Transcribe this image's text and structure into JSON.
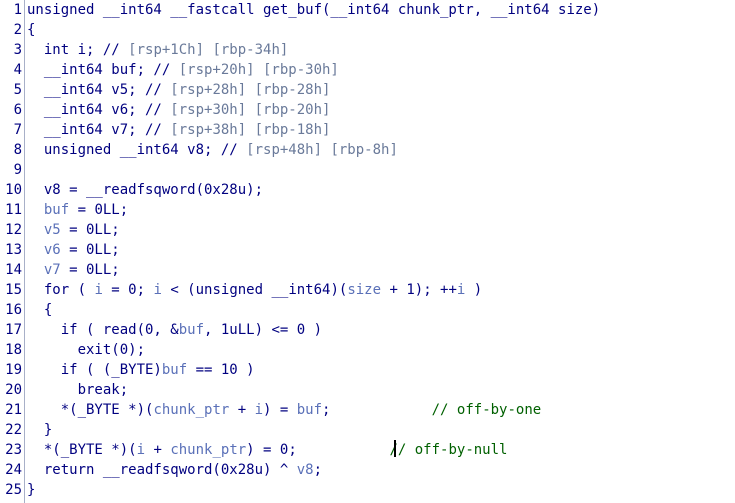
{
  "lines": [
    {
      "n": "1",
      "tokens": [
        [
          "unsigned __int64 __fastcall get_buf(__int64 chunk_ptr, __int64 size)",
          "plain"
        ]
      ]
    },
    {
      "n": "2",
      "tokens": [
        [
          "{",
          "plain"
        ]
      ]
    },
    {
      "n": "3",
      "tokens": [
        [
          "  int i; // ",
          "plain"
        ],
        [
          "[rsp+1Ch] [rbp-34h]",
          "cmt"
        ]
      ]
    },
    {
      "n": "4",
      "tokens": [
        [
          "  __int64 buf; // ",
          "plain"
        ],
        [
          "[rsp+20h] [rbp-30h]",
          "cmt"
        ]
      ]
    },
    {
      "n": "5",
      "tokens": [
        [
          "  __int64 v5; // ",
          "plain"
        ],
        [
          "[rsp+28h] [rbp-28h]",
          "cmt"
        ]
      ]
    },
    {
      "n": "6",
      "tokens": [
        [
          "  __int64 v6; // ",
          "plain"
        ],
        [
          "[rsp+30h] [rbp-20h]",
          "cmt"
        ]
      ]
    },
    {
      "n": "7",
      "tokens": [
        [
          "  __int64 v7; // ",
          "plain"
        ],
        [
          "[rsp+38h] [rbp-18h]",
          "cmt"
        ]
      ]
    },
    {
      "n": "8",
      "tokens": [
        [
          "  unsigned __int64 v8; // ",
          "plain"
        ],
        [
          "[rsp+48h] [rbp-8h]",
          "cmt"
        ]
      ]
    },
    {
      "n": "9",
      "tokens": [
        [
          "",
          "plain"
        ]
      ]
    },
    {
      "n": "10",
      "tokens": [
        [
          "  v8 = __readfsqword(0x28u);",
          "plain"
        ]
      ]
    },
    {
      "n": "11",
      "tokens": [
        [
          "  ",
          "plain"
        ],
        [
          "buf",
          "var"
        ],
        [
          " = 0LL;",
          "plain"
        ]
      ]
    },
    {
      "n": "12",
      "tokens": [
        [
          "  ",
          "plain"
        ],
        [
          "v5",
          "var"
        ],
        [
          " = 0LL;",
          "plain"
        ]
      ]
    },
    {
      "n": "13",
      "tokens": [
        [
          "  ",
          "plain"
        ],
        [
          "v6",
          "var"
        ],
        [
          " = 0LL;",
          "plain"
        ]
      ]
    },
    {
      "n": "14",
      "tokens": [
        [
          "  ",
          "plain"
        ],
        [
          "v7",
          "var"
        ],
        [
          " = 0LL;",
          "plain"
        ]
      ]
    },
    {
      "n": "15",
      "tokens": [
        [
          "  for ( ",
          "plain"
        ],
        [
          "i",
          "var"
        ],
        [
          " = 0; ",
          "plain"
        ],
        [
          "i",
          "var"
        ],
        [
          " < (unsigned __int64)(",
          "plain"
        ],
        [
          "size",
          "var"
        ],
        [
          " + 1); ++",
          "plain"
        ],
        [
          "i",
          "var"
        ],
        [
          " )",
          "plain"
        ]
      ]
    },
    {
      "n": "16",
      "tokens": [
        [
          "  {",
          "plain"
        ]
      ]
    },
    {
      "n": "17",
      "tokens": [
        [
          "    if ( read(0, &",
          "plain"
        ],
        [
          "buf",
          "var"
        ],
        [
          ", 1uLL) <= 0 )",
          "plain"
        ]
      ]
    },
    {
      "n": "18",
      "tokens": [
        [
          "      exit(0);",
          "plain"
        ]
      ]
    },
    {
      "n": "19",
      "tokens": [
        [
          "    if ( (_BYTE)",
          "plain"
        ],
        [
          "buf",
          "var"
        ],
        [
          " == 10 )",
          "plain"
        ]
      ]
    },
    {
      "n": "20",
      "tokens": [
        [
          "      break;",
          "plain"
        ]
      ]
    },
    {
      "n": "21",
      "tokens": [
        [
          "    *(_BYTE *)(",
          "plain"
        ],
        [
          "chunk_ptr",
          "var"
        ],
        [
          " + ",
          "plain"
        ],
        [
          "i",
          "var"
        ],
        [
          ") = ",
          "plain"
        ],
        [
          "buf",
          "var"
        ],
        [
          ";",
          "plain"
        ],
        [
          "            // off-by-one",
          "green"
        ]
      ]
    },
    {
      "n": "22",
      "tokens": [
        [
          "  }",
          "plain"
        ]
      ]
    },
    {
      "n": "23",
      "tokens": [
        [
          "  *(_BYTE *)(",
          "plain"
        ],
        [
          "i",
          "var"
        ],
        [
          " + ",
          "plain"
        ],
        [
          "chunk_ptr",
          "var"
        ],
        [
          ") = 0;",
          "plain"
        ],
        [
          "           // off-by-null",
          "green"
        ]
      ]
    },
    {
      "n": "24",
      "tokens": [
        [
          "  return __readfsqword(0x28u) ^ ",
          "plain"
        ],
        [
          "v8",
          "var"
        ],
        [
          ";",
          "plain"
        ]
      ]
    },
    {
      "n": "25",
      "tokens": [
        [
          "}",
          "plain"
        ]
      ]
    }
  ]
}
